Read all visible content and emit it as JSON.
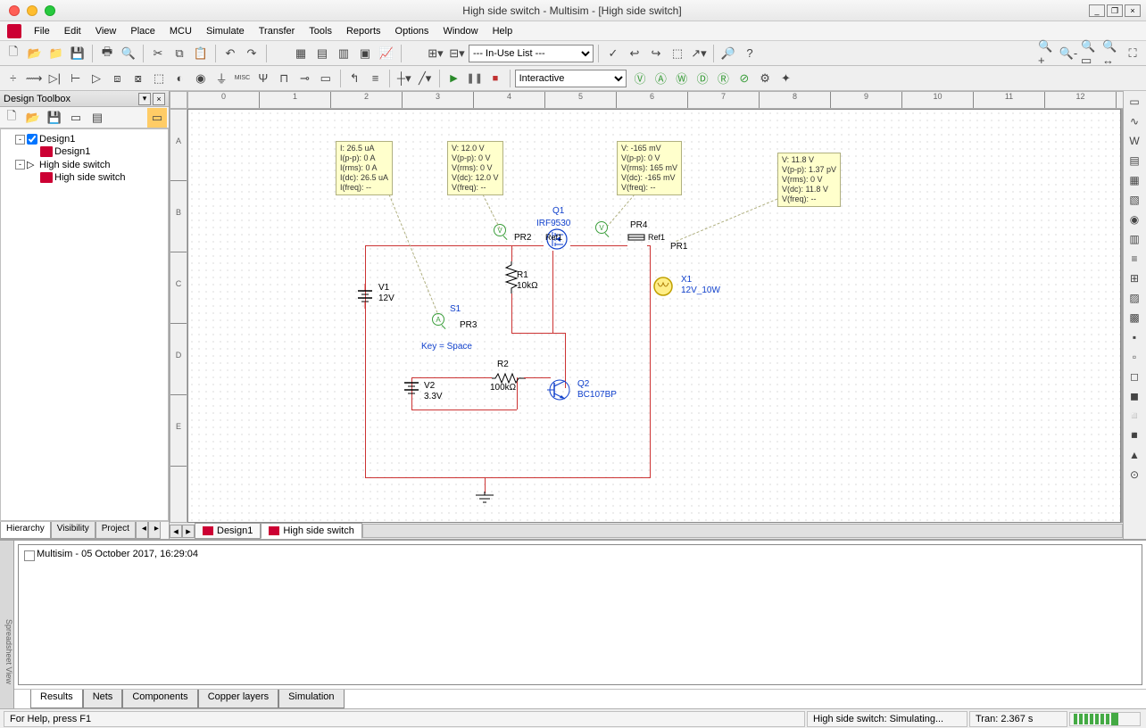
{
  "window": {
    "title": "High side switch - Multisim - [High side switch]"
  },
  "menubar": [
    "File",
    "Edit",
    "View",
    "Place",
    "MCU",
    "Simulate",
    "Transfer",
    "Tools",
    "Reports",
    "Options",
    "Window",
    "Help"
  ],
  "toolbar1": {
    "inuse_list": "--- In-Use List ---"
  },
  "toolbar2": {
    "sim_mode": "Interactive"
  },
  "toolbox": {
    "title": "Design Toolbox",
    "tree": {
      "root1": "Design1",
      "child1": "Design1",
      "root2": "High side switch",
      "child2": "High side switch"
    },
    "tabs": [
      "Hierarchy",
      "Visibility",
      "Project"
    ]
  },
  "ruler_h": [
    "0",
    "1",
    "2",
    "3",
    "4",
    "5",
    "6",
    "7",
    "8",
    "9",
    "10",
    "11",
    "12"
  ],
  "ruler_v": [
    "A",
    "B",
    "C",
    "D",
    "E"
  ],
  "tooltips": {
    "pr3": "I: 26.5 uA\nI(p-p): 0 A\nI(rms): 0 A\nI(dc): 26.5 uA\nI(freq): --",
    "pr2": "V: 12.0 V\nV(p-p): 0 V\nV(rms): 0 V\nV(dc): 12.0 V\nV(freq): --",
    "pr4": "V: -165 mV\nV(p-p): 0 V\nV(rms): 165 mV\nV(dc): -165 mV\nV(freq): --",
    "pr1": "V: 11.8 V\nV(p-p): 1.37 pV\nV(rms): 0 V\nV(dc): 11.8 V\nV(freq): --"
  },
  "components": {
    "q1_ref": "Q1",
    "q1_val": "IRF9530",
    "q1_refl": "Ref1",
    "pr2_lbl": "PR2",
    "pr4_lbl": "PR4",
    "pr4_ref": "Ref1",
    "pr1_lbl": "PR1",
    "v1_ref": "V1",
    "v1_val": "12V",
    "r1_ref": "R1",
    "r1_val": "10kΩ",
    "x1_ref": "X1",
    "x1_val": "12V_10W",
    "s1_ref": "S1",
    "s1_key": "Key = Space",
    "pr3_lbl": "PR3",
    "v2_ref": "V2",
    "v2_val": "3.3V",
    "r2_ref": "R2",
    "r2_val": "100kΩ",
    "q2_ref": "Q2",
    "q2_val": "BC107BP"
  },
  "doc_tabs": {
    "tab1": "Design1",
    "tab2": "High side switch"
  },
  "spreadsheet": {
    "log": "Multisim  -  05 October 2017, 16:29:04",
    "tabs": [
      "Results",
      "Nets",
      "Components",
      "Copper layers",
      "Simulation"
    ]
  },
  "statusbar": {
    "help": "For Help, press F1",
    "sim": "High side switch: Simulating...",
    "tran": "Tran: 2.367 s"
  }
}
